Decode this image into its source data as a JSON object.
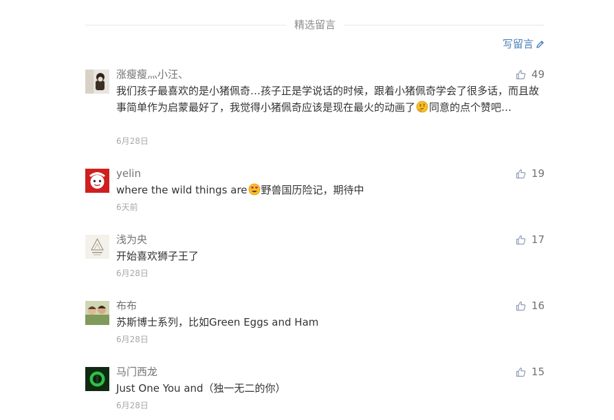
{
  "section": {
    "title": "精选留言"
  },
  "write_comment": {
    "label": "写留言",
    "icon": "pencil-icon",
    "color": "#4a7db7"
  },
  "comments": [
    {
      "nickname": "涨瘦瘦灬小汪、",
      "likes": "49",
      "content_before": "我们孩子最喜欢的是小猪佩奇…孩子正是学说话的时候，跟着小猪佩奇学会了很多话，而且故事简单作为启蒙最好了，我觉得小猪佩奇应该是现在最火的动画了",
      "emoji": "thinking-emoji",
      "content_after": "同意的点个赞吧…",
      "date": "6月28日"
    },
    {
      "nickname": "yelin",
      "likes": "19",
      "content_before": "where the wild things are",
      "emoji": "heart-eyes-emoji",
      "content_after": "野兽国历险记，期待中",
      "date": "6天前"
    },
    {
      "nickname": "浅为央",
      "likes": "17",
      "content": "开始喜欢狮子王了",
      "date": "6月28日"
    },
    {
      "nickname": "布布",
      "likes": "16",
      "content": "苏斯博士系列，比如Green Eggs and Ham",
      "date": "6月28日"
    },
    {
      "nickname": "马门西龙",
      "likes": "15",
      "content": "Just One You and（独一无二的你）",
      "date": "6月28日"
    }
  ]
}
